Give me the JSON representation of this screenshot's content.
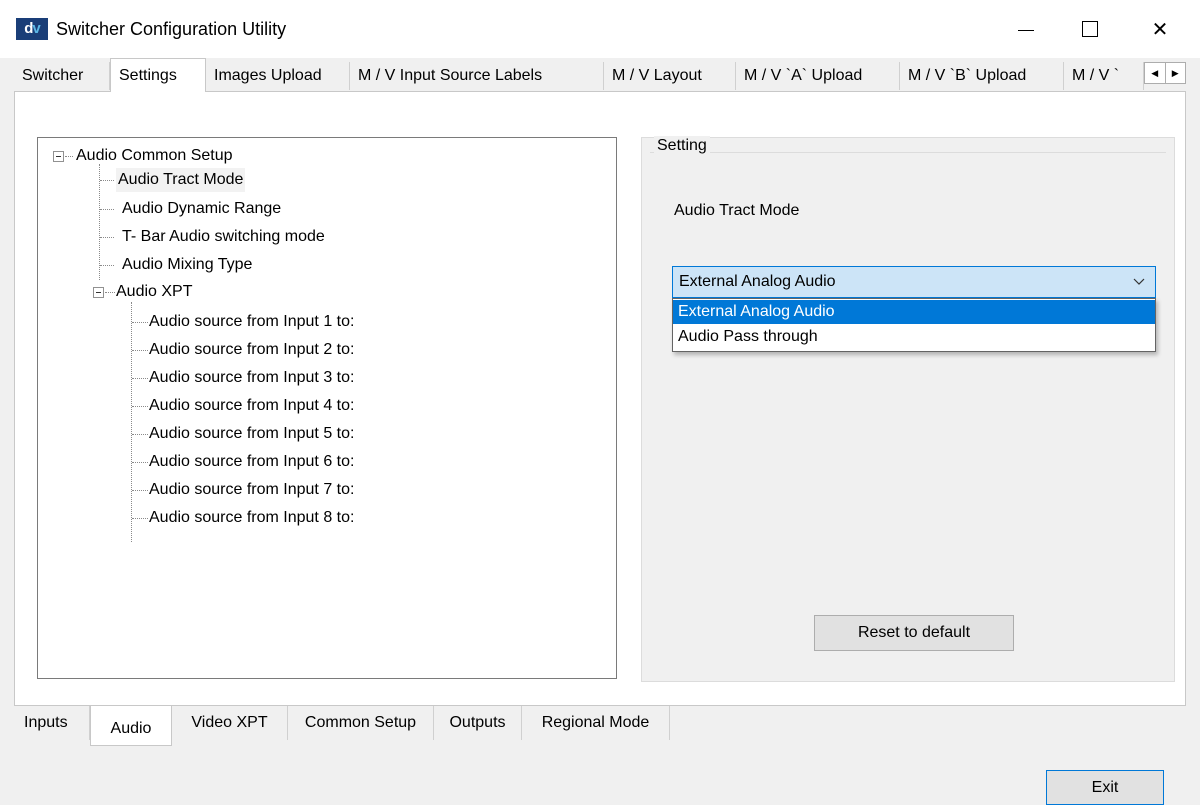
{
  "window": {
    "logo_text_d": "d",
    "logo_text_v": "v",
    "title": "Switcher Configuration Utility",
    "minimize_icon": "minimize-icon",
    "maximize_icon": "maximize-icon",
    "close_icon": "close-icon",
    "close_glyph": "✕"
  },
  "top_tabs": [
    {
      "label": "Switcher",
      "active": false
    },
    {
      "label": "Settings",
      "active": true
    },
    {
      "label": "Images Upload",
      "active": false
    },
    {
      "label": "M / V  Input Source Labels",
      "active": false
    },
    {
      "label": "M / V Layout",
      "active": false
    },
    {
      "label": "M / V `A` Upload",
      "active": false
    },
    {
      "label": "M / V `B` Upload",
      "active": false
    },
    {
      "label": "M / V `",
      "active": false
    }
  ],
  "tab_scroll": {
    "left_glyph": "◀",
    "right_glyph": "▶"
  },
  "tree": {
    "root": {
      "label": "Audio Common Setup",
      "expanded": true
    },
    "items": [
      {
        "label": "Audio Tract Mode",
        "selected": true
      },
      {
        "label": "Audio Dynamic Range"
      },
      {
        "label": "T- Bar Audio switching mode"
      },
      {
        "label": "Audio Mixing Type"
      }
    ],
    "xpt": {
      "label": "Audio XPT",
      "expanded": true
    },
    "xpt_items": [
      {
        "label": "Audio source from Input 1 to:"
      },
      {
        "label": "Audio source from Input 2 to:"
      },
      {
        "label": "Audio source from Input 3 to:"
      },
      {
        "label": "Audio source from Input 4 to:"
      },
      {
        "label": "Audio source from Input 5 to:"
      },
      {
        "label": "Audio source from Input 6 to:"
      },
      {
        "label": "Audio source from Input 7 to:"
      },
      {
        "label": "Audio source from Input 8 to:"
      }
    ]
  },
  "setting": {
    "group_title": "Setting",
    "label": "Audio Tract Mode",
    "combo_value": "External Analog Audio",
    "options": [
      "External Analog Audio",
      "Audio Pass through"
    ],
    "highlighted_option": "External Analog Audio",
    "reset_label": "Reset to default"
  },
  "bottom_tabs": [
    {
      "label": "Inputs",
      "active": false
    },
    {
      "label": "Audio",
      "active": true
    },
    {
      "label": "Video XPT",
      "active": false
    },
    {
      "label": "Common Setup",
      "active": false
    },
    {
      "label": "Outputs",
      "active": false
    },
    {
      "label": "Regional Mode",
      "active": false
    }
  ],
  "exit_label": "Exit",
  "colors": {
    "accent": "#0078d7",
    "combo_bg": "#cce4f7",
    "logo_bg": "#1a3e78"
  }
}
